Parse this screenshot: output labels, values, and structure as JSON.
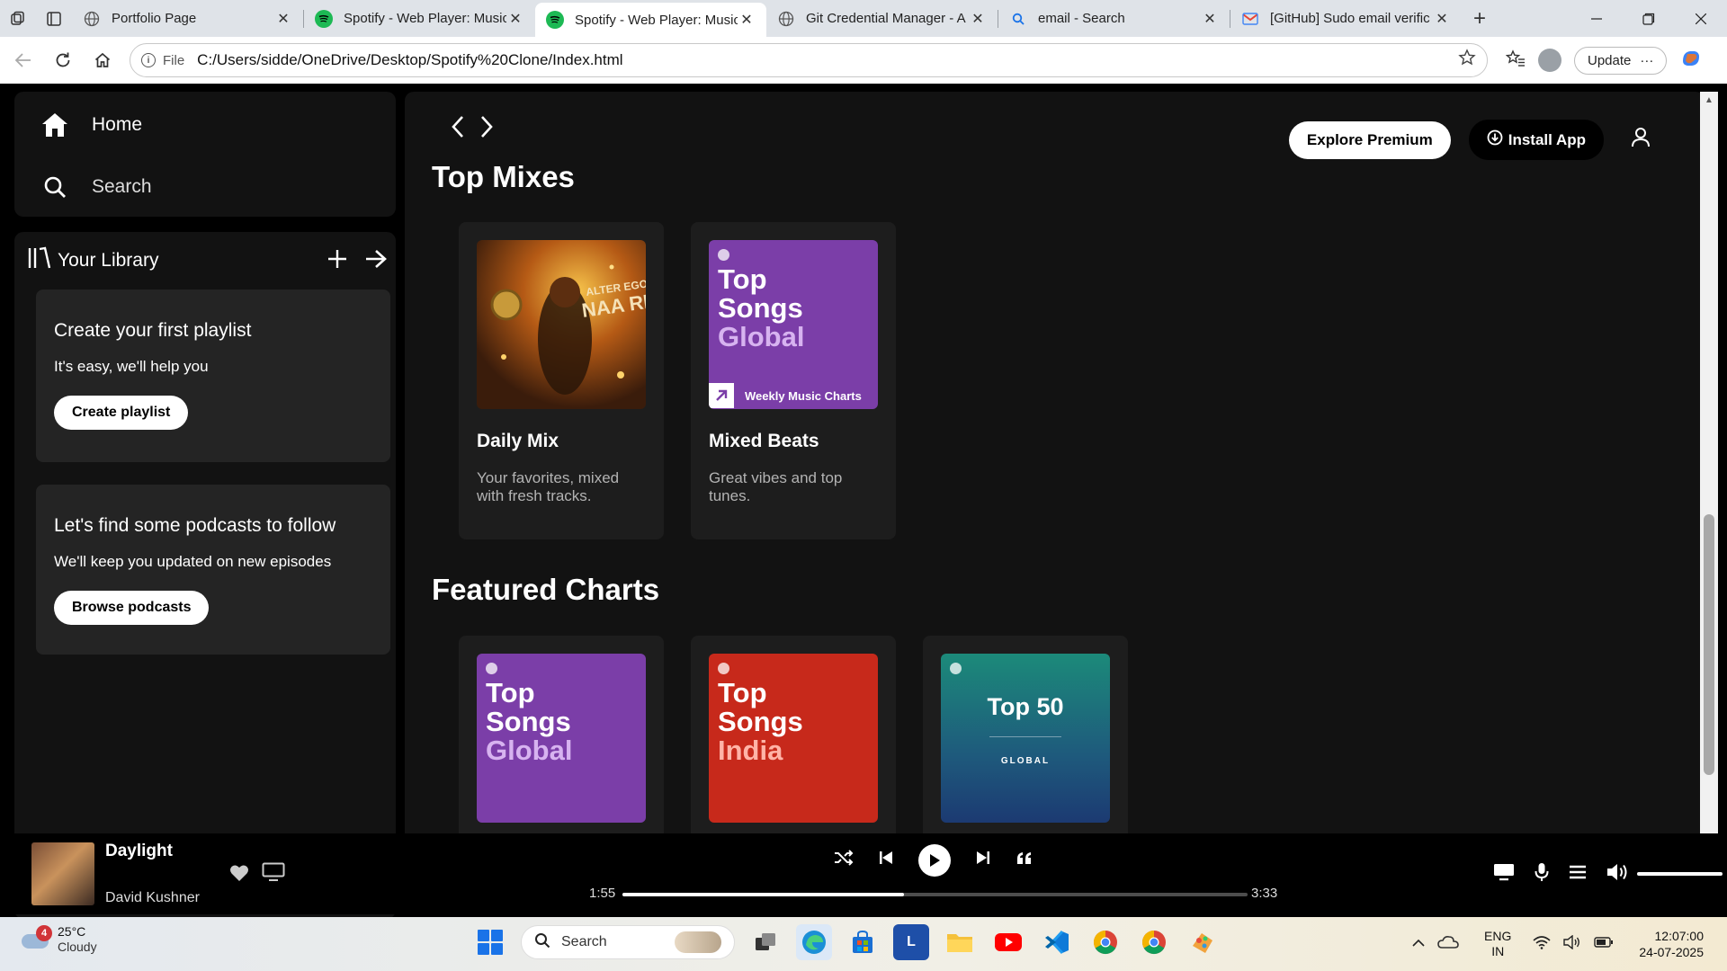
{
  "browser": {
    "tabs": [
      {
        "label": "Portfolio Page",
        "active": false
      },
      {
        "label": "Spotify - Web Player: Music",
        "active": false
      },
      {
        "label": "Spotify - Web Player: Music",
        "active": true
      },
      {
        "label": "Git Credential Manager - A",
        "active": false
      },
      {
        "label": "email - Search",
        "active": false
      },
      {
        "label": "[GitHub] Sudo email verific",
        "active": false
      }
    ],
    "close_glyph": "✕",
    "new_tab_glyph": "+",
    "file_label": "File",
    "url": "C:/Users/sidde/OneDrive/Desktop/Spotify%20Clone/Index.html",
    "update_label": "Update",
    "more_glyph": "···"
  },
  "sidebar": {
    "home_label": "Home",
    "search_label": "Search",
    "library_label": "Your Library",
    "playlist_card": {
      "title": "Create your first playlist",
      "text": "It's easy, we'll help you",
      "button": "Create playlist"
    },
    "podcast_card": {
      "title": "Let's find some podcasts to follow",
      "text": "We'll keep you updated on new episodes",
      "button": "Browse podcasts"
    }
  },
  "main": {
    "explore_premium": "Explore Premium",
    "install_app": "Install App",
    "top_mixes_title": "Top Mixes",
    "featured_title": "Featured Charts",
    "mixes": [
      {
        "title": "Daily Mix",
        "desc": "Your favorites, mixed with fresh tracks.",
        "art_text_1": "ALTER EGO",
        "art_text_2": "NAA READY"
      },
      {
        "title": "Mixed Beats",
        "desc": "Great vibes and top tunes.",
        "art_l1": "Top",
        "art_l2": "Songs",
        "art_l3": "Global",
        "band": "Weekly Music Charts"
      }
    ],
    "charts": [
      {
        "l1": "Top",
        "l2": "Songs",
        "l3": "Global"
      },
      {
        "l1": "Top",
        "l2": "Songs",
        "l3": "India"
      },
      {
        "title": "Top 50",
        "sub": "GLOBAL"
      }
    ]
  },
  "player": {
    "track": "Daylight",
    "artist": "David Kushner",
    "elapsed": "1:55",
    "duration": "3:33",
    "progress_fraction": 0.45,
    "volume_fraction": 1.0
  },
  "taskbar": {
    "weather_temp": "25°C",
    "weather_desc": "Cloudy",
    "weather_badge": "4",
    "search_label": "Search",
    "lang_1": "ENG",
    "lang_2": "IN",
    "time": "12:07:00",
    "date": "24-07-2025",
    "apps": [
      "Task View",
      "Edge",
      "Store",
      "L",
      "Files",
      "YouTube",
      "VS Code",
      "Chrome A",
      "Chrome B",
      "Paint"
    ]
  },
  "colors": {
    "spotify_green": "#1DB954",
    "panel_bg": "#121212",
    "card_bg": "#242424",
    "purple_chart": "#7B3EA8",
    "red_chart": "#C7291B"
  }
}
